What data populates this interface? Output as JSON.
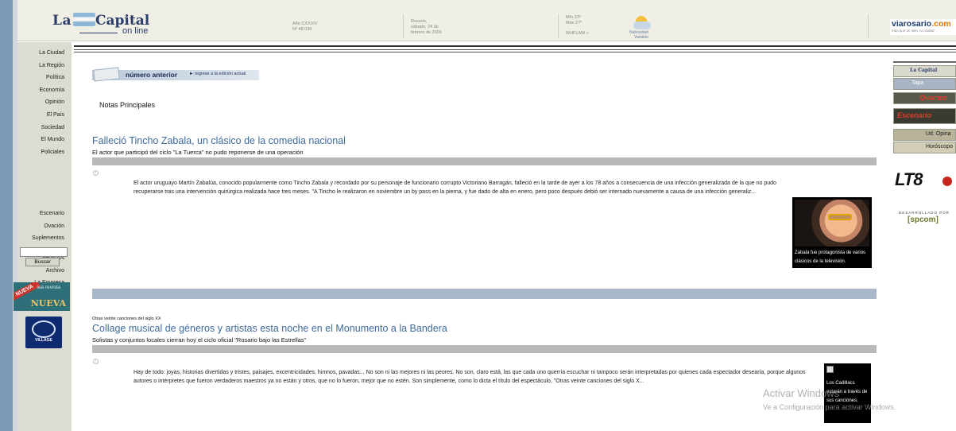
{
  "header": {
    "logo_la": "La",
    "logo_capital": "Capital",
    "logo_online": "on line",
    "year_line1": "Año CXXXIV",
    "year_line2": "Nº 48.039",
    "date_line1": "Rosario,",
    "date_line2": "sábado, 24 de",
    "date_line3": "febrero de 2001",
    "temp_min": "Mín 23º",
    "temp_max": "Máx 27º",
    "weather_source": "WHFLAW »",
    "weather_cond1": "Nubosidad",
    "weather_cond2": "Variable",
    "partner_name_a": "viarosario",
    "partner_name_b": ".com",
    "partner_tagline": "más que un sitio, tu ciudad"
  },
  "leftnav": {
    "group1": [
      "La Ciudad",
      "La Región",
      "Política",
      "Economía",
      "Opinión",
      "El País",
      "Sociedad",
      "El Mundo",
      "Policiales"
    ],
    "group2": [
      "Escenario",
      "Ovación",
      "Suplementos"
    ],
    "group3": [
      "Servicios",
      "Archivo",
      "La Empresa"
    ],
    "search_value": "",
    "search_button": "Buscar",
    "ad_revista_tag": "NUEVA",
    "ad_revista_lea": "lea revista",
    "ad_revista_big": "NUEVA",
    "ad_village": "VILLAGE"
  },
  "main": {
    "numero_anterior": "número anterior",
    "regreso": "► regrese a la edición actual",
    "section_title": "Notas Principales",
    "article1": {
      "headline": "Falleció Tincho Zabala, un clásico de la comedia nacional",
      "subhead": "El actor que participó del ciclo \"La Tuerca\" no pudo reponerse de una operación",
      "body": "El actor uruguayo Martín Zabalúa, conocido popularmente como Tincho Zabala y recordado por su personaje de funcionario corrupto Victoriano Barragán, falleció en la tarde de ayer a los 78 años a consecuencia de una infección generalizada de la que no pudo recuperarse tras una intervención quirúrgica realizada hace tres meses. \"A Tincho le realizaron en noviembre un by pass en la pierna, y fue dado de alta en enero, pero poco después debió ser internado nuevamente a causa de una infección generaliz...",
      "photo_caption": "Zabala fue protagonista de varios clásicos de la televisión."
    },
    "article2": {
      "kicker": "Otras veinte canciones del siglo XX",
      "headline": "Collage musical de géneros y artistas esta noche en el Monumento a la Bandera",
      "subhead": "Solistas y conjuntos locales cierran hoy el ciclo oficial \"Rosario bajo las Estrellas\"",
      "body": "Hay de todo: joyas, historias divertidas y tristes, paisajes, excentricidades, himnos, pavadas... No son ni las mejores ni las peores. No son, claro está, las que cada uno querría escuchar ni tampoco serán interpretadas por quienes cada espectador desearía, porque algunos autores o intérpretes que fueron verdaderos maestros ya no están y otros, que no lo fueron, mejor que no estén. Son simplemente, como lo dicta el título del espectáculo, \"Otras veinte canciones del siglo X...",
      "photo_caption": "Los Cadillacs estarán a través de sus canciones."
    }
  },
  "rightcol": {
    "buttons": [
      "La Capital",
      "Tapa",
      "Ovacion",
      "Escenario",
      "Ud. Opina",
      "Horóscopo"
    ],
    "lt8": "LT8",
    "developed_by": "DESARROLLADO POR",
    "spcom": "[spcom]"
  },
  "watermark": {
    "line1": "Activar Windows",
    "line2": "Ve a Configuración para activar Windows."
  }
}
